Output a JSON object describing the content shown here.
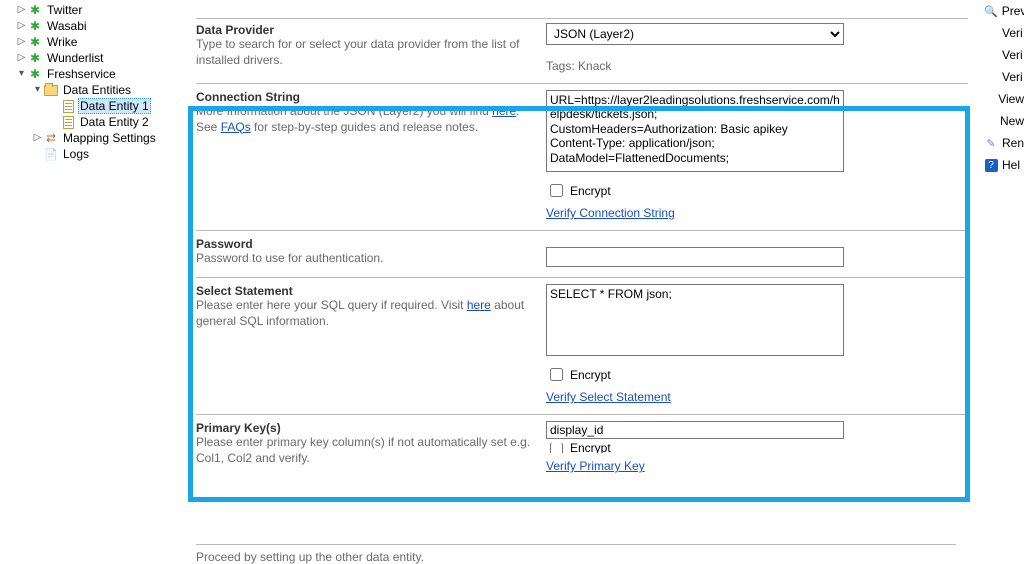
{
  "tree": {
    "twitter": "Twitter",
    "wasabi": "Wasabi",
    "wrike": "Wrike",
    "wunderlist": "Wunderlist",
    "freshservice": "Freshservice",
    "data_entities": "Data Entities",
    "data_entity_1": "Data Entity 1",
    "data_entity_2": "Data Entity 2",
    "mapping_settings": "Mapping Settings",
    "logs": "Logs"
  },
  "data_provider": {
    "title": "Data Provider",
    "desc": "Type to search for or select your data provider from the list of installed drivers.",
    "selected": "JSON (Layer2)",
    "tags_label": "Tags: Knack"
  },
  "connection_string": {
    "title": "Connection String",
    "desc_before": "More Information about the JSON (Layer2) you will find ",
    "link1": "here",
    "desc_mid": ". See ",
    "link2": "FAQs",
    "desc_after": " for step-by-step guides and release notes.",
    "value": "URL=https://layer2leadingsolutions.freshservice.com/helpdesk/tickets.json;\nCustomHeaders=Authorization: Basic apikey\nContent-Type: application/json;\nDataModel=FlattenedDocuments;",
    "encrypt_label": "Encrypt",
    "verify_link": "Verify Connection String"
  },
  "password": {
    "title": "Password",
    "desc": "Password to use for authentication."
  },
  "select_stmt": {
    "title": "Select Statement",
    "desc_before": "Please enter here your SQL query if required. Visit ",
    "link": "here",
    "desc_after": " about general SQL information.",
    "value": "SELECT * FROM json;",
    "encrypt_label": "Encrypt",
    "verify_link": "Verify Select Statement"
  },
  "primary_key": {
    "title": "Primary Key(s)",
    "desc": "Please enter primary key column(s) if not automatically set e.g. Col1, Col2 and verify.",
    "value": "display_id",
    "encrypt_label": "Encrypt",
    "verify_link": "Verify Primary Key"
  },
  "proceed_text": "Proceed by setting up the other data entity.",
  "right_panel": {
    "prev": "Prev",
    "veri1": "Veri",
    "veri2": "Veri",
    "veri3": "Veri",
    "view": "View",
    "new": "New",
    "ren": "Ren",
    "help": "Hel"
  }
}
